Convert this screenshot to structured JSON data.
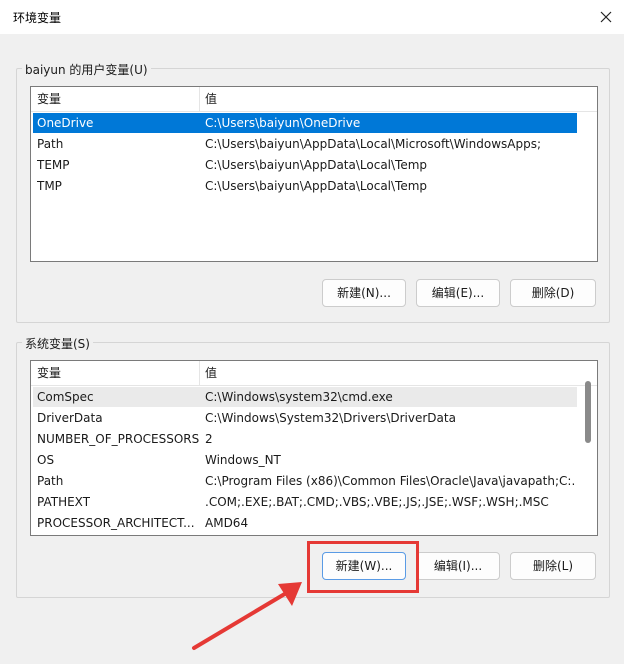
{
  "window": {
    "title": "环境变量"
  },
  "user_vars": {
    "label": "baiyun 的用户变量(U)",
    "header_name": "变量",
    "header_value": "值",
    "rows": [
      {
        "name": "OneDrive",
        "value": "C:\\Users\\baiyun\\OneDrive",
        "selected": true
      },
      {
        "name": "Path",
        "value": "C:\\Users\\baiyun\\AppData\\Local\\Microsoft\\WindowsApps;"
      },
      {
        "name": "TEMP",
        "value": "C:\\Users\\baiyun\\AppData\\Local\\Temp"
      },
      {
        "name": "TMP",
        "value": "C:\\Users\\baiyun\\AppData\\Local\\Temp"
      }
    ],
    "buttons": {
      "new": "新建(N)...",
      "edit": "编辑(E)...",
      "delete": "删除(D)"
    }
  },
  "system_vars": {
    "label": "系统变量(S)",
    "header_name": "变量",
    "header_value": "值",
    "rows": [
      {
        "name": "ComSpec",
        "value": "C:\\Windows\\system32\\cmd.exe"
      },
      {
        "name": "DriverData",
        "value": "C:\\Windows\\System32\\Drivers\\DriverData"
      },
      {
        "name": "NUMBER_OF_PROCESSORS",
        "value": "2"
      },
      {
        "name": "OS",
        "value": "Windows_NT"
      },
      {
        "name": "Path",
        "value": "C:\\Program Files (x86)\\Common Files\\Oracle\\Java\\javapath;C:..."
      },
      {
        "name": "PATHEXT",
        "value": ".COM;.EXE;.BAT;.CMD;.VBS;.VBE;.JS;.JSE;.WSF;.WSH;.MSC"
      },
      {
        "name": "PROCESSOR_ARCHITECT...",
        "value": "AMD64"
      }
    ],
    "buttons": {
      "new": "新建(W)...",
      "edit": "编辑(I)...",
      "delete": "删除(L)"
    }
  },
  "colors": {
    "selection": "#0078d7",
    "highlight": "#e53935"
  }
}
